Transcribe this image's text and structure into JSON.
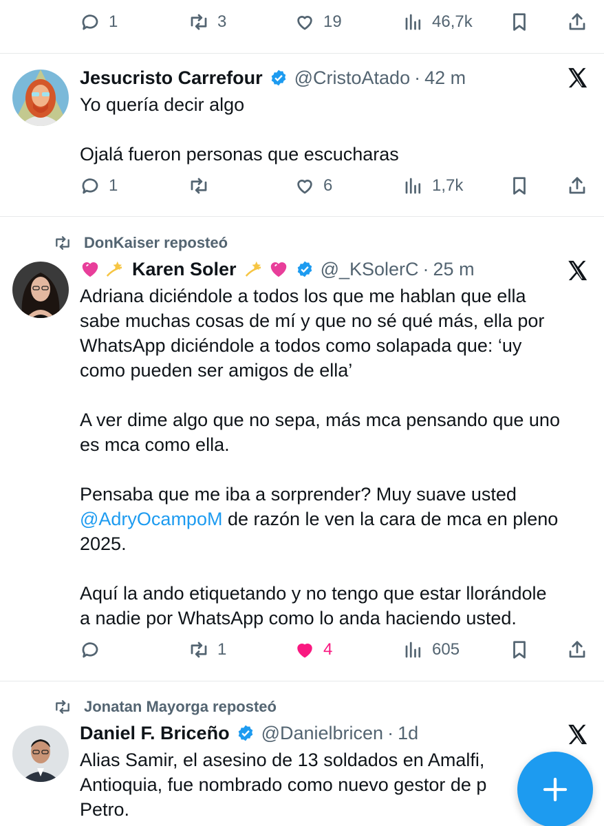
{
  "colors": {
    "accent": "#1d9bf0",
    "muted": "#536471",
    "like": "#f91880",
    "text": "#0f1419"
  },
  "top_actions": {
    "reply": "1",
    "repost": "3",
    "like": "19",
    "views": "46,7k"
  },
  "tweets": [
    {
      "name": "Jesucristo Carrefour",
      "handle": "@CristoAtado",
      "dot": "·",
      "time": "42 m",
      "body": "Yo quería decir algo\n\nOjalá fueron personas que escucharas",
      "actions": {
        "reply": "1",
        "repost": "",
        "like": "6",
        "views": "1,7k"
      }
    },
    {
      "repost_label": "DonKaiser reposteó",
      "name": "Karen Soler",
      "name_emojis": [
        "pink-heart",
        "dizzy-star"
      ],
      "handle": "@_KSolerC",
      "dot": "·",
      "time": "25 m",
      "body_part1": "Adriana diciéndole a todos los que me hablan que ella\nsabe muchas cosas de mí y que no sé qué más, ella por\nWhatsApp diciéndole a todos como solapada que: ‘uy\ncomo pueden ser amigos de ella’\n\nA ver dime algo que no sepa, más mca pensando que uno\nes mca como ella.\n\nPensaba que me iba a sorprender? Muy suave usted\n",
      "mention": "@AdryOcampoM",
      "body_part2": " de razón le ven la cara de mca en pleno\n2025.\n\nAquí la ando etiquetando y no tengo que estar llorándole\na nadie por WhatsApp como lo anda haciendo usted.",
      "actions": {
        "reply": "",
        "repost": "1",
        "like": "4",
        "views": "605"
      }
    },
    {
      "repost_label": "Jonatan Mayorga reposteó",
      "name": "Daniel F. Briceño",
      "handle": "@Danielbricen",
      "dot": "·",
      "time": "1d",
      "body": "Alias Samir, el asesino de 13 soldados en Amalfi,\nAntioquia, fue nombrado como nuevo gestor de p\nPetro."
    }
  ],
  "icons": [
    "reply-icon",
    "repost-icon",
    "like-icon",
    "views-icon",
    "bookmark-icon",
    "share-icon",
    "verified-badge-icon",
    "x-logo-icon",
    "compose-plus-icon"
  ]
}
